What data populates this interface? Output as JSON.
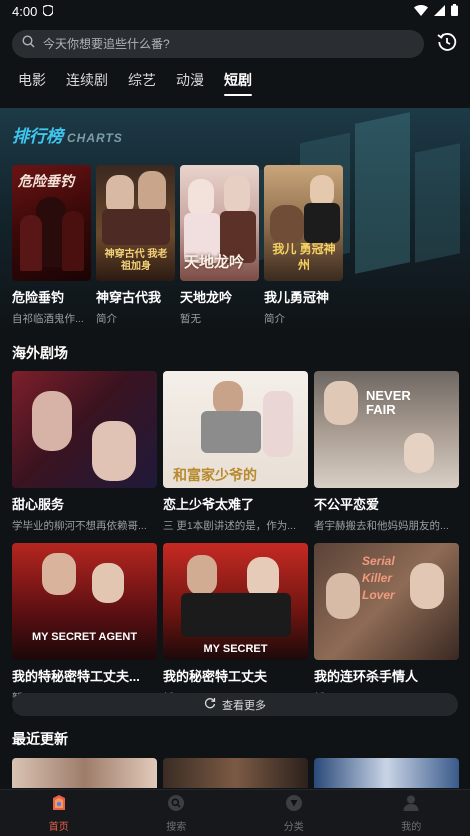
{
  "status": {
    "time": "4:00"
  },
  "search": {
    "placeholder": "今天你想要追些什么番?"
  },
  "tabs": [
    {
      "label": "电影"
    },
    {
      "label": "连续剧"
    },
    {
      "label": "综艺"
    },
    {
      "label": "动漫"
    },
    {
      "label": "短剧"
    }
  ],
  "active_tab": "短剧",
  "ranking": {
    "title_cn": "排行榜",
    "title_en": "CHARTS",
    "items": [
      {
        "title": "危险垂钓",
        "sub": "自祁临酒鬼作...",
        "poster_text": "危险垂钓"
      },
      {
        "title": "神穿古代我",
        "sub": "简介",
        "poster_text": "神穿古代 我老祖加身"
      },
      {
        "title": "天地龙吟",
        "sub": "暂无",
        "poster_text": "天地龙吟"
      },
      {
        "title": "我儿勇冠神",
        "sub": "简介",
        "poster_text": "我儿 勇冠神州"
      }
    ]
  },
  "overseas": {
    "title": "海外剧场",
    "items": [
      {
        "title": "甜心服务",
        "sub": "学毕业的柳河不想再依赖哥...",
        "poster_text": ""
      },
      {
        "title": "恋上少爷太难了",
        "sub": "三 更1本剧讲述的是，作为...",
        "poster_text": "和富家少爷的"
      },
      {
        "title": "不公平恋爱",
        "sub": "者宇赫搬去和他妈妈朋友的...",
        "poster_text": "NEVER FAIR"
      },
      {
        "title": "我的特秘密特工丈夫...",
        "sub": "暂无",
        "poster_text": "MY SECRET AGENT"
      },
      {
        "title": "我的秘密特工丈夫",
        "sub": "暂无",
        "poster_text": "MY SECRET"
      },
      {
        "title": "我的连环杀手情人",
        "sub": "暂无",
        "poster_text": "Serial Killer Lover"
      }
    ],
    "more_label": "查看更多"
  },
  "recent": {
    "title": "最近更新"
  },
  "nav": [
    {
      "label": "首页",
      "icon": "home-icon"
    },
    {
      "label": "搜索",
      "icon": "search-icon"
    },
    {
      "label": "分类",
      "icon": "category-icon"
    },
    {
      "label": "我的",
      "icon": "profile-icon"
    }
  ],
  "colors": {
    "accent": "#e8614a",
    "rank_title": "#3ec6ef",
    "bg": "#101316"
  }
}
